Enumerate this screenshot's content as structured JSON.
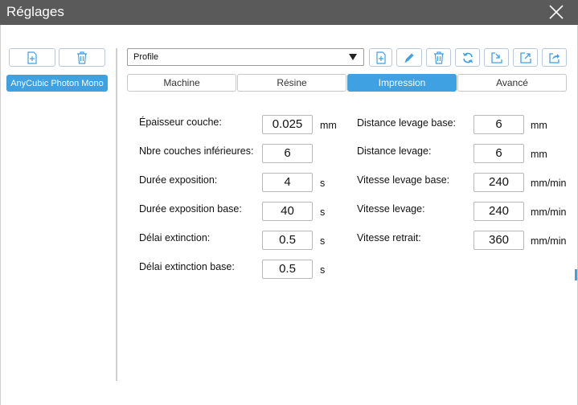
{
  "window": {
    "title": "Réglages"
  },
  "profiles": {
    "items": [
      {
        "label": "AnyCubic Photon Mono",
        "selected": true
      }
    ]
  },
  "toolbar": {
    "profile_select": {
      "value": "Profile"
    },
    "icons": [
      "add-file-icon",
      "edit-pencil-icon",
      "trash-icon",
      "refresh-icon",
      "import-icon",
      "export-icon",
      "share-icon"
    ]
  },
  "tabs": [
    {
      "label": "Machine",
      "active": false
    },
    {
      "label": "Résine",
      "active": false
    },
    {
      "label": "Impression",
      "active": true
    },
    {
      "label": "Avancé",
      "active": false
    }
  ],
  "settings_left": [
    {
      "label": "Épaisseur couche:",
      "value": "0.025",
      "unit": "mm"
    },
    {
      "label": "Nbre couches inférieures:",
      "value": "6",
      "unit": ""
    },
    {
      "label": "Durée exposition:",
      "value": "4",
      "unit": "s"
    },
    {
      "label": "Durée exposition base:",
      "value": "40",
      "unit": "s"
    },
    {
      "label": "Délai extinction:",
      "value": "0.5",
      "unit": "s"
    },
    {
      "label": "Délai extinction base:",
      "value": "0.5",
      "unit": "s"
    }
  ],
  "settings_right": [
    {
      "label": "Distance levage base:",
      "value": "6",
      "unit": "mm"
    },
    {
      "label": "Distance levage:",
      "value": "6",
      "unit": "mm"
    },
    {
      "label": "Vitesse levage base:",
      "value": "240",
      "unit": "mm/min"
    },
    {
      "label": "Vitesse levage:",
      "value": "240",
      "unit": "mm/min"
    },
    {
      "label": "Vitesse retrait:",
      "value": "360",
      "unit": "mm/min"
    }
  ],
  "colors": {
    "accent": "#3fa0e2",
    "titlebar": "#5a5a5a",
    "icon": "#3fa0e2"
  }
}
